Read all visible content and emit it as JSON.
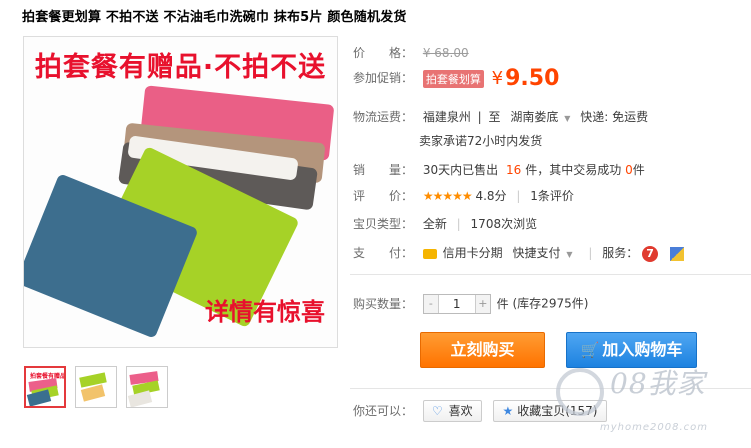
{
  "product": {
    "title": "拍套餐更划算 不拍不送 不沾油毛巾洗碗巾 抹布5片 颜色随机发货"
  },
  "image": {
    "banner_top": "拍套餐有赠品·不拍不送",
    "banner_bottom": "详情有惊喜",
    "thumb_caption": "拍套餐有赠品·不拍不送"
  },
  "price": {
    "label": "价　　格：",
    "original": "¥ 68.00"
  },
  "promo": {
    "label": "参加促销：",
    "tag": "拍套餐划算",
    "yen": "¥",
    "price": "9.50"
  },
  "shipping": {
    "label": "物流运费：",
    "from": "福建泉州",
    "sep": "|",
    "to_prefix": "至",
    "to": "湖南娄底",
    "express": "快递: 免运费",
    "promise": "卖家承诺72小时内发货"
  },
  "sales": {
    "label": "销　　量：",
    "prefix": "30天内已售出",
    "sold": "16",
    "unit": "件",
    "middle": "，其中交易成功",
    "success": "0",
    "unit2": "件"
  },
  "rating": {
    "label": "评　　价：",
    "stars": "★★★★★",
    "score": "4.8分",
    "count": "1条评价"
  },
  "type": {
    "label": "宝贝类型：",
    "condition": "全新",
    "views": "1708次浏览"
  },
  "payment": {
    "label": "支　　付：",
    "credit": "信用卡分期",
    "quick": "快捷支付",
    "service_label": "服务：",
    "service_icon_text": "7"
  },
  "quantity": {
    "label": "购买数量：",
    "value": "1",
    "minus": "-",
    "plus": "+",
    "unit": "件",
    "stock": "(库存2975件)"
  },
  "actions": {
    "buy_now": "立刻购买",
    "add_cart": "加入购物车",
    "cart_icon": "🛒"
  },
  "social": {
    "label": "你还可以：",
    "like": "喜欢",
    "favorite": "收藏宝贝",
    "favorite_count": "(157)"
  },
  "watermark": {
    "text": "08我家",
    "url": "myhome2008.com"
  },
  "colors": {
    "price": "#ff4400",
    "buy_button": "#ff7300",
    "cart_button": "#1d82e0",
    "banner_red": "#e8112d"
  }
}
